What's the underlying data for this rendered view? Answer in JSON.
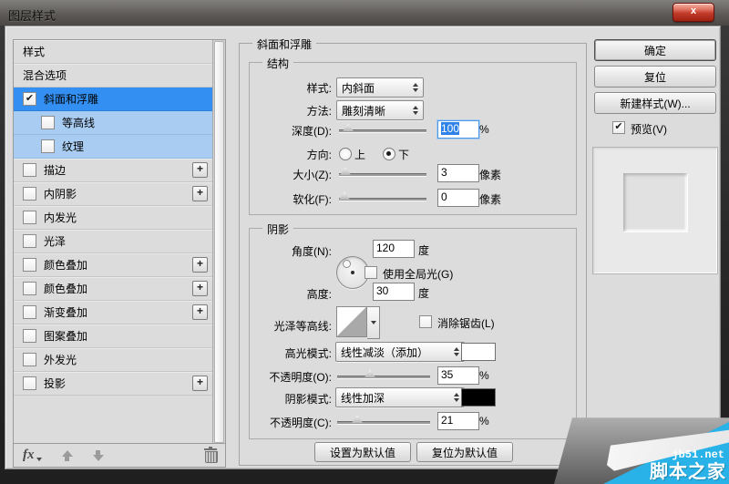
{
  "window": {
    "title": "图层样式",
    "close_glyph": "x"
  },
  "glyphs": {
    "check": "✔",
    "plus": "+"
  },
  "sidebar": {
    "items": [
      {
        "label": "样式",
        "checkbox": false,
        "checked": false,
        "sub": false,
        "selected": false,
        "plus": false
      },
      {
        "label": "混合选项",
        "checkbox": false,
        "checked": false,
        "sub": false,
        "selected": false,
        "plus": false
      },
      {
        "label": "斜面和浮雕",
        "checkbox": true,
        "checked": true,
        "sub": false,
        "selected": true,
        "plus": false
      },
      {
        "label": "等高线",
        "checkbox": true,
        "checked": false,
        "sub": true,
        "selected": false,
        "plus": false
      },
      {
        "label": "纹理",
        "checkbox": true,
        "checked": false,
        "sub": true,
        "selected": false,
        "plus": false
      },
      {
        "label": "描边",
        "checkbox": true,
        "checked": false,
        "sub": false,
        "selected": false,
        "plus": true
      },
      {
        "label": "内阴影",
        "checkbox": true,
        "checked": false,
        "sub": false,
        "selected": false,
        "plus": true
      },
      {
        "label": "内发光",
        "checkbox": true,
        "checked": false,
        "sub": false,
        "selected": false,
        "plus": false
      },
      {
        "label": "光泽",
        "checkbox": true,
        "checked": false,
        "sub": false,
        "selected": false,
        "plus": false
      },
      {
        "label": "颜色叠加",
        "checkbox": true,
        "checked": false,
        "sub": false,
        "selected": false,
        "plus": true
      },
      {
        "label": "颜色叠加",
        "checkbox": true,
        "checked": false,
        "sub": false,
        "selected": false,
        "plus": true
      },
      {
        "label": "渐变叠加",
        "checkbox": true,
        "checked": false,
        "sub": false,
        "selected": false,
        "plus": true
      },
      {
        "label": "图案叠加",
        "checkbox": true,
        "checked": false,
        "sub": false,
        "selected": false,
        "plus": false
      },
      {
        "label": "外发光",
        "checkbox": true,
        "checked": false,
        "sub": false,
        "selected": false,
        "plus": false
      },
      {
        "label": "投影",
        "checkbox": true,
        "checked": false,
        "sub": false,
        "selected": false,
        "plus": true
      }
    ],
    "footer": {
      "fx_label": "fx"
    }
  },
  "panel": {
    "title": "斜面和浮雕",
    "structure": {
      "legend": "结构",
      "style_label": "样式:",
      "style_value": "内斜面",
      "technique_label": "方法:",
      "technique_value": "雕刻清晰",
      "depth_label": "深度(D):",
      "depth_value": "100",
      "depth_unit": "%",
      "direction_label": "方向:",
      "direction_up": "上",
      "direction_down": "下",
      "size_label": "大小(Z):",
      "size_value": "3",
      "size_unit": "像素",
      "soften_label": "软化(F):",
      "soften_value": "0",
      "soften_unit": "像素"
    },
    "shading": {
      "legend": "阴影",
      "angle_label": "角度(N):",
      "angle_value": "120",
      "angle_unit": "度",
      "global_light_label": "使用全局光(G)",
      "altitude_label": "高度:",
      "altitude_value": "30",
      "altitude_unit": "度",
      "gloss_contour_label": "光泽等高线:",
      "anti_alias_label": "消除锯齿(L)",
      "highlight_mode_label": "高光模式:",
      "highlight_mode_value": "线性减淡（添加）",
      "highlight_opacity_label": "不透明度(O):",
      "highlight_opacity_value": "35",
      "highlight_opacity_unit": "%",
      "shadow_mode_label": "阴影模式:",
      "shadow_mode_value": "线性加深",
      "shadow_opacity_label": "不透明度(C):",
      "shadow_opacity_value": "21",
      "shadow_opacity_unit": "%"
    },
    "footer_buttons": {
      "make_default": "设置为默认值",
      "reset_default": "复位为默认值"
    }
  },
  "actions": {
    "ok": "确定",
    "reset": "复位",
    "new_style": "新建样式(W)...",
    "preview": "预览(V)"
  },
  "watermark": {
    "site": "jb51.net",
    "name": "脚本之家"
  },
  "colors": {
    "selected_row": "#3390f2",
    "sub_row": "#a9cdf2",
    "highlight_swatch": "#ffffff",
    "shadow_swatch": "#000000",
    "watermark_cyan": "#29b2e8"
  }
}
